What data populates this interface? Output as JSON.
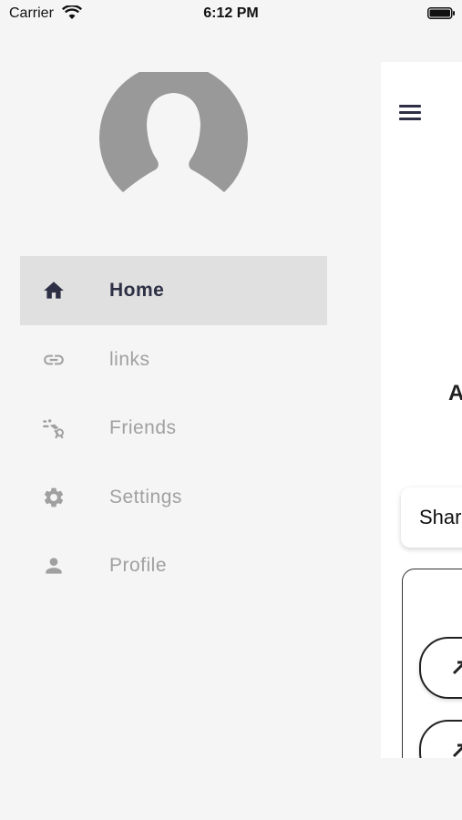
{
  "status_bar": {
    "carrier": "Carrier",
    "time": "6:12 PM"
  },
  "drawer": {
    "avatar_icon": "default-user-avatar",
    "items": [
      {
        "label": "Home",
        "icon": "home-icon",
        "active": true
      },
      {
        "label": "links",
        "icon": "link-icon",
        "active": false
      },
      {
        "label": "Friends",
        "icon": "friends-icon",
        "active": false
      },
      {
        "label": "Settings",
        "icon": "gear-icon",
        "active": false
      },
      {
        "label": "Profile",
        "icon": "person-icon",
        "active": false
      }
    ]
  },
  "main": {
    "heading": "A",
    "share_label": "Shar"
  },
  "colors": {
    "active_text": "#2d2f45",
    "inactive_text": "#a0a0a0",
    "active_bg": "#e0e0e0",
    "avatar": "#999999"
  }
}
